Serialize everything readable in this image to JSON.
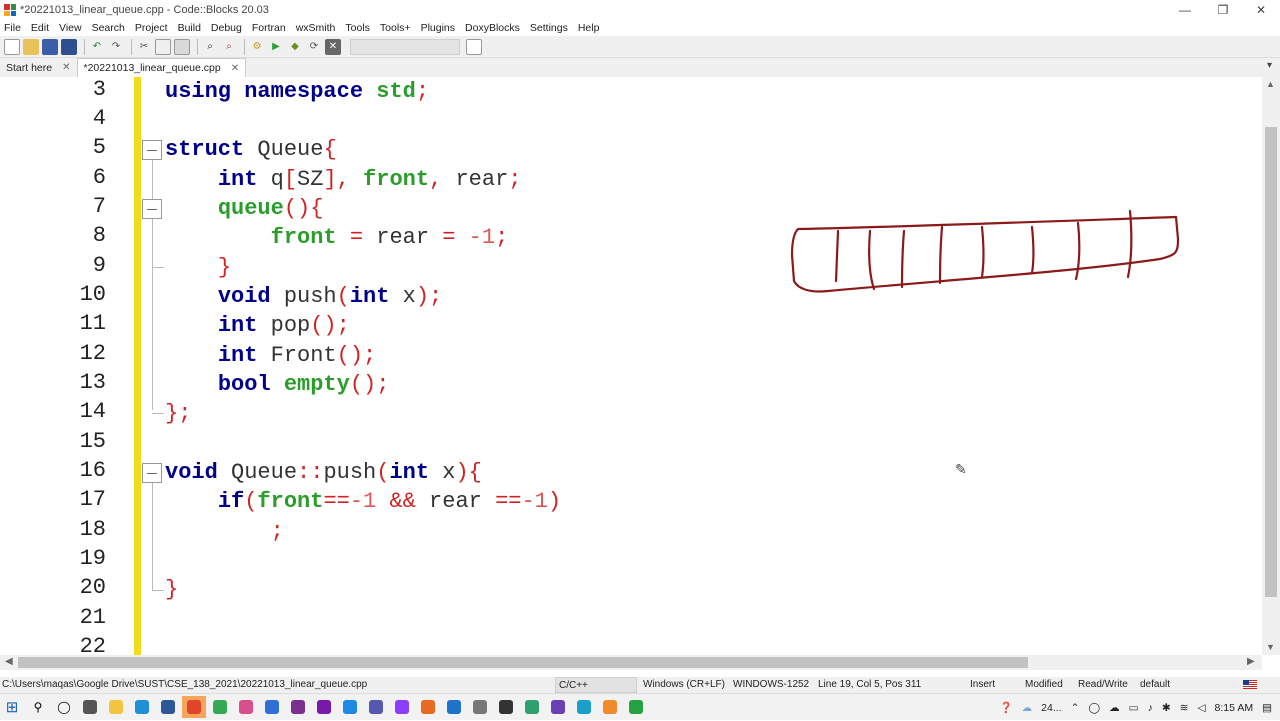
{
  "window": {
    "title": "*20221013_linear_queue.cpp - Code::Blocks 20.03",
    "controls": {
      "minimize": "—",
      "maximize": "❐",
      "close": "✕"
    }
  },
  "menu": [
    "File",
    "Edit",
    "View",
    "Search",
    "Project",
    "Build",
    "Debug",
    "Fortran",
    "wxSmith",
    "Tools",
    "Tools+",
    "Plugins",
    "DoxyBlocks",
    "Settings",
    "Help"
  ],
  "tabs": {
    "items": [
      {
        "label": "Start here",
        "close": "✕"
      },
      {
        "label": "*20221013_linear_queue.cpp",
        "close": "✕"
      }
    ],
    "menu_glyph": "▾"
  },
  "editor": {
    "line_numbers": [
      "3",
      "4",
      "5",
      "6",
      "7",
      "8",
      "9",
      "10",
      "11",
      "12",
      "13",
      "14",
      "15",
      "16",
      "17",
      "18",
      "19",
      "20",
      "21",
      "22"
    ],
    "code": [
      [
        [
          "kw",
          "using"
        ],
        [
          "id",
          " "
        ],
        [
          "kw",
          "namespace"
        ],
        [
          "id",
          " "
        ],
        [
          "kw2",
          "std"
        ],
        [
          "op",
          ";"
        ]
      ],
      [],
      [
        [
          "kw",
          "struct"
        ],
        [
          "id",
          " Queue"
        ],
        [
          "op",
          "{"
        ]
      ],
      [
        [
          "id",
          "    "
        ],
        [
          "kw",
          "int"
        ],
        [
          "id",
          " q"
        ],
        [
          "op",
          "["
        ],
        [
          "id",
          "SZ"
        ],
        [
          "op",
          "],"
        ],
        [
          "id",
          " "
        ],
        [
          "kw2",
          "front"
        ],
        [
          "op",
          ","
        ],
        [
          "id",
          " rear"
        ],
        [
          "op",
          ";"
        ]
      ],
      [
        [
          "id",
          "    "
        ],
        [
          "kw2",
          "queue"
        ],
        [
          "op",
          "(){"
        ]
      ],
      [
        [
          "id",
          "        "
        ],
        [
          "kw2",
          "front"
        ],
        [
          "id",
          " "
        ],
        [
          "op",
          "="
        ],
        [
          "id",
          " rear "
        ],
        [
          "op",
          "="
        ],
        [
          "id",
          " "
        ],
        [
          "num",
          "-1"
        ],
        [
          "op",
          ";"
        ]
      ],
      [
        [
          "id",
          "    "
        ],
        [
          "op",
          "}"
        ]
      ],
      [
        [
          "id",
          "    "
        ],
        [
          "kw",
          "void"
        ],
        [
          "id",
          " push"
        ],
        [
          "op",
          "("
        ],
        [
          "kw",
          "int"
        ],
        [
          "id",
          " x"
        ],
        [
          "op",
          ");"
        ]
      ],
      [
        [
          "id",
          "    "
        ],
        [
          "kw",
          "int"
        ],
        [
          "id",
          " pop"
        ],
        [
          "op",
          "();"
        ]
      ],
      [
        [
          "id",
          "    "
        ],
        [
          "kw",
          "int"
        ],
        [
          "id",
          " Front"
        ],
        [
          "op",
          "();"
        ]
      ],
      [
        [
          "id",
          "    "
        ],
        [
          "kw",
          "bool"
        ],
        [
          "id",
          " "
        ],
        [
          "kw2",
          "empty"
        ],
        [
          "op",
          "();"
        ]
      ],
      [
        [
          "op",
          "};"
        ]
      ],
      [],
      [
        [
          "kw",
          "void"
        ],
        [
          "id",
          " Queue"
        ],
        [
          "op",
          "::"
        ],
        [
          "id",
          "push"
        ],
        [
          "op",
          "("
        ],
        [
          "kw",
          "int"
        ],
        [
          "id",
          " x"
        ],
        [
          "op",
          "){"
        ]
      ],
      [
        [
          "id",
          "    "
        ],
        [
          "kw",
          "if"
        ],
        [
          "op",
          "("
        ],
        [
          "kw2",
          "front"
        ],
        [
          "op",
          "=="
        ],
        [
          "num",
          "-1"
        ],
        [
          "id",
          " "
        ],
        [
          "op",
          "&&"
        ],
        [
          "id",
          " rear "
        ],
        [
          "op",
          "=="
        ],
        [
          "num",
          "-1"
        ],
        [
          "op",
          ")"
        ]
      ],
      [
        [
          "id",
          "        "
        ],
        [
          "op",
          ";"
        ]
      ],
      [],
      [
        [
          "op",
          "}"
        ]
      ],
      [],
      []
    ]
  },
  "statusbar": {
    "path": "C:\\Users\\maqas\\Google Drive\\SUST\\CSE_138_2021\\20221013_linear_queue.cpp",
    "language": "C/C++",
    "line_endings": "Windows (CR+LF)",
    "encoding": "WINDOWS-1252",
    "position": "Line 19, Col 5, Pos 311",
    "insert_mode": "Insert",
    "modified": "Modified",
    "access": "Read/Write",
    "profile": "default"
  },
  "taskbar": {
    "start_glyph": "⊞",
    "search_glyph": "⚲",
    "taskview_glyph": "◯",
    "apps": [
      {
        "name": "task-view",
        "color": "#555555"
      },
      {
        "name": "file-explorer",
        "color": "#f4c542"
      },
      {
        "name": "edge",
        "color": "#1f8fd6"
      },
      {
        "name": "word",
        "color": "#2b5797"
      },
      {
        "name": "chrome",
        "color": "#e0452b"
      },
      {
        "name": "app-green",
        "color": "#35a853"
      },
      {
        "name": "app-pink",
        "color": "#d94f8c"
      },
      {
        "name": "app-blue",
        "color": "#2f6fd6"
      },
      {
        "name": "codeblocks",
        "color": "#7b2f8f"
      },
      {
        "name": "onenote",
        "color": "#7719aa"
      },
      {
        "name": "vscode",
        "color": "#1e88e5"
      },
      {
        "name": "teams",
        "color": "#5558af"
      },
      {
        "name": "messenger",
        "color": "#8a3ffc"
      },
      {
        "name": "app-orange",
        "color": "#e86a1f"
      },
      {
        "name": "mail",
        "color": "#1e73c9"
      },
      {
        "name": "network",
        "color": "#777777"
      },
      {
        "name": "terminal",
        "color": "#333333"
      },
      {
        "name": "app-teal",
        "color": "#2e9f6e"
      },
      {
        "name": "app-purple",
        "color": "#6a3fb5"
      },
      {
        "name": "app-cyan",
        "color": "#1aa0c8"
      },
      {
        "name": "browser-orange",
        "color": "#f08a2a"
      },
      {
        "name": "whatsapp",
        "color": "#25a244"
      }
    ],
    "temperature": "24...",
    "time": "8:15 AM"
  },
  "colors": {
    "marker": "#f0dc1a",
    "keyword": "#00008b",
    "keyword2": "#2a9d2a",
    "operator": "#d02222",
    "ink": "#8b1a1a"
  }
}
